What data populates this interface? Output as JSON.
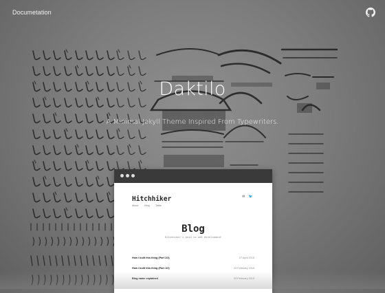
{
  "nav": {
    "docs_label": "Documetation",
    "github_icon": "github-icon"
  },
  "hero": {
    "title": "Daktilo",
    "subtitle": "A Minimal Jekyll Theme Inspired From Typewriters."
  },
  "preview": {
    "site_name": "Hitchhiker",
    "nav": [
      "About",
      "Blog",
      "Talks"
    ],
    "social_icons": [
      "mail-icon",
      "twitter-icon"
    ],
    "blog_heading": "Blog",
    "blog_tagline": "Hitchhiker's guid to web development",
    "posts": [
      {
        "title": "How I built this thing (Part 2/3)",
        "date": "27 April 2015"
      },
      {
        "title": "How I built this thing (Part 1/2)",
        "date": "23 February 2015"
      },
      {
        "title": "Blog name explained",
        "date": "03 February 2015"
      }
    ]
  },
  "colors": {
    "accent_dark": "#3a3a3a",
    "text_light": "#ffffff"
  }
}
